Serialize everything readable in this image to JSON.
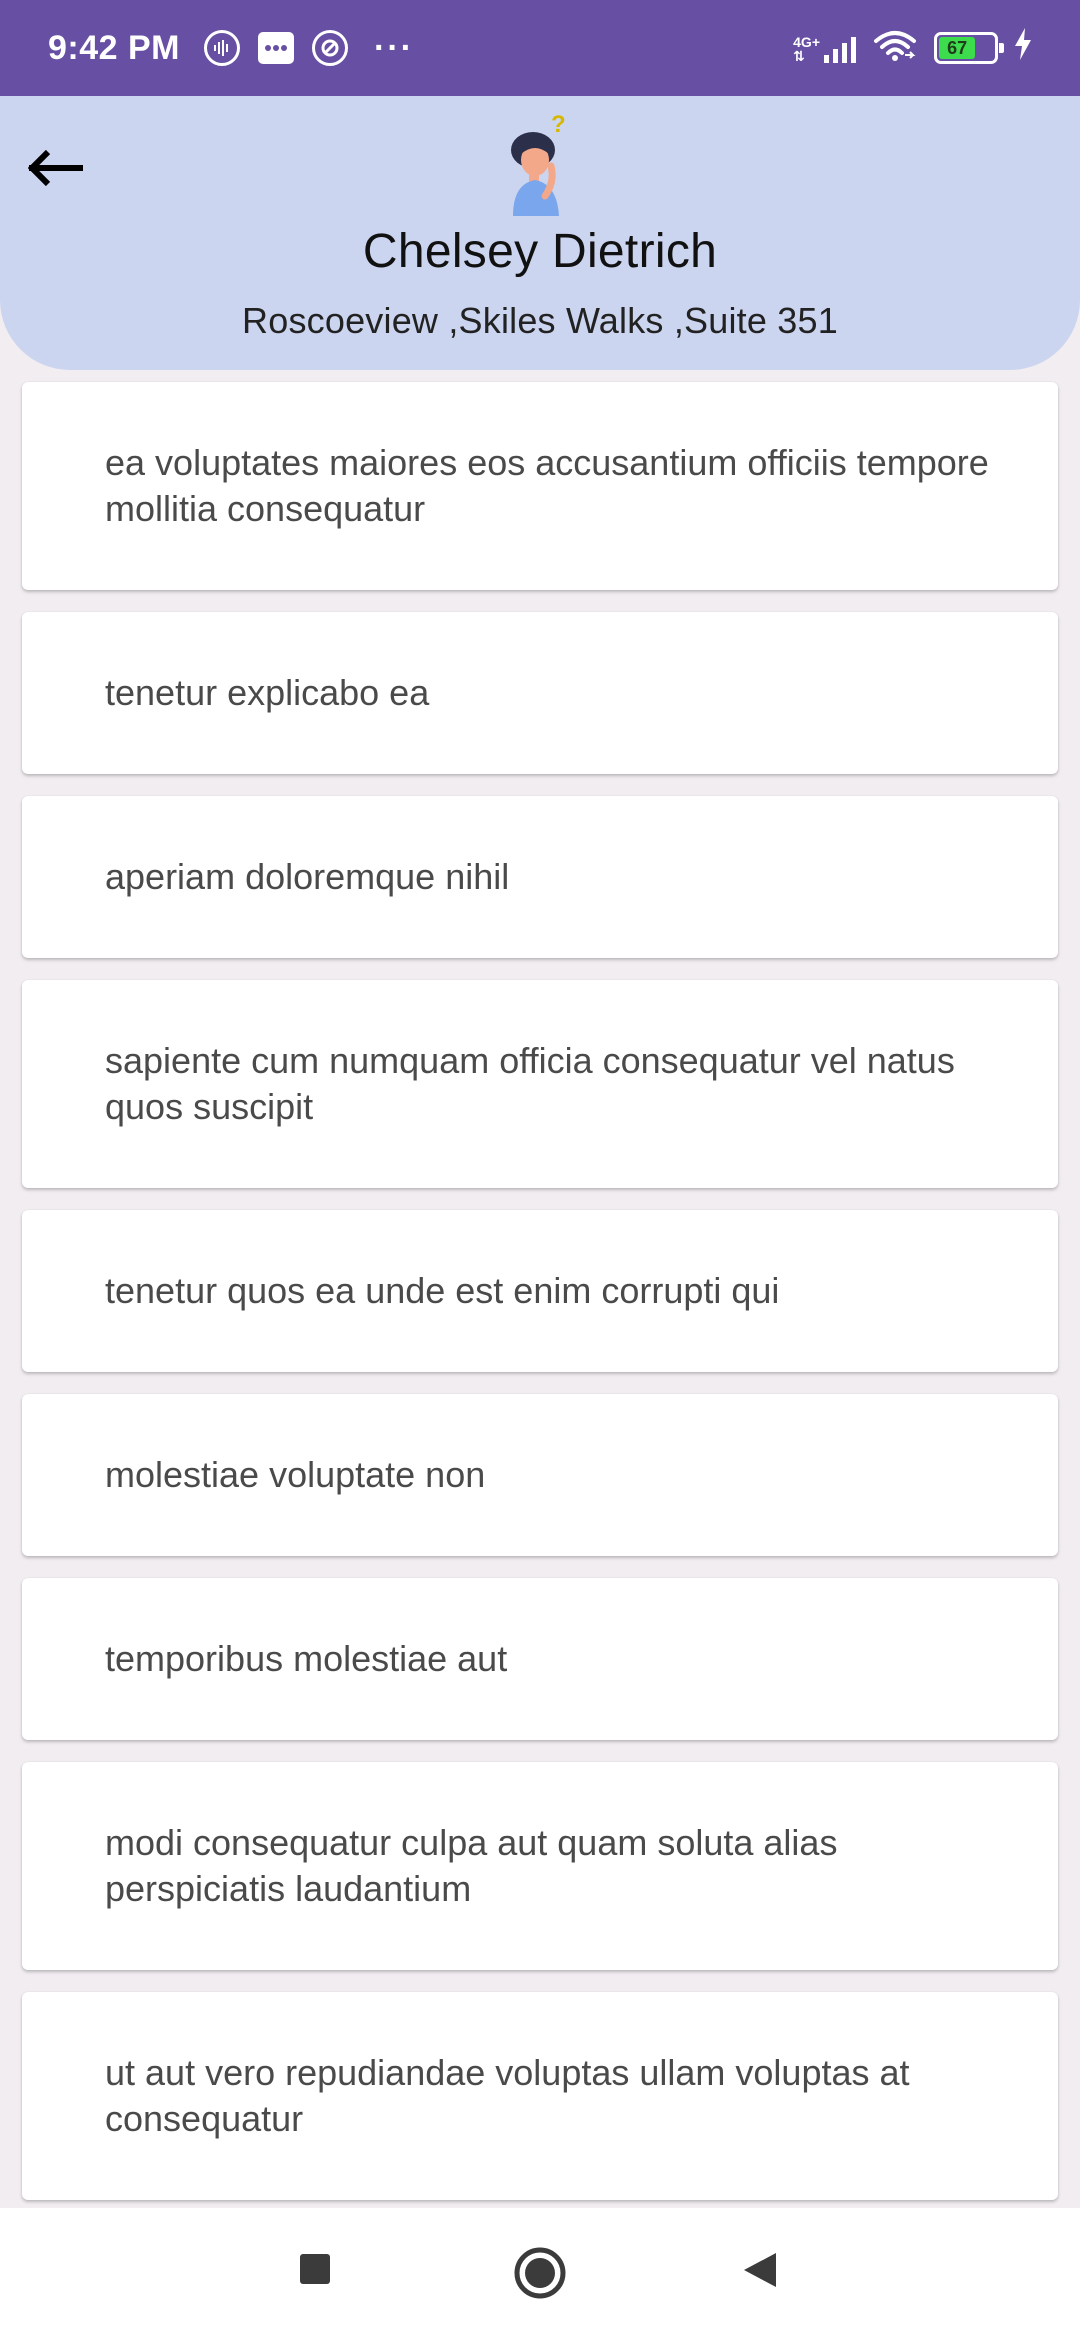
{
  "status_bar": {
    "time": "9:42 PM",
    "more_indicator": "···",
    "network_label_top": "4G+",
    "battery_level": "67",
    "battery_fraction": 0.67,
    "icons": [
      "audio-icon",
      "message-icon",
      "data-saver-icon",
      "signal-icon",
      "wifi-icon",
      "battery-icon",
      "charging-icon"
    ]
  },
  "header": {
    "name": "Chelsey Dietrich",
    "address": "Roscoeview ,Skiles Walks ,Suite 351",
    "background": "#ccd5f0"
  },
  "items": [
    "ea voluptates maiores eos accusantium officiis tempore mollitia consequatur",
    "tenetur explicabo ea",
    "aperiam doloremque nihil",
    "sapiente cum numquam officia consequatur vel natus quos suscipit",
    "tenetur quos ea unde est enim corrupti qui",
    "molestiae voluptate non",
    "temporibus molestiae aut",
    "modi consequatur culpa aut quam soluta alias perspiciatis laudantium",
    "ut aut vero repudiandae voluptas ullam voluptas at consequatur"
  ],
  "colors": {
    "status_bar": "#6750a4",
    "page_background": "#f1edf1"
  }
}
